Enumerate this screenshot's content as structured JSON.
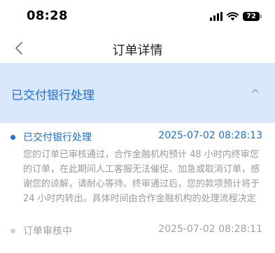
{
  "status_bar": {
    "time": "08:28",
    "battery": "72",
    "icons": [
      "signal-icon",
      "wifi-icon",
      "battery-icon"
    ]
  },
  "nav": {
    "back_glyph": "‹",
    "title": "订单详情"
  },
  "status_panel": {
    "title": "已交付银行处理",
    "toggle_icon": "chevron-up-icon"
  },
  "timeline": {
    "items": [
      {
        "title": "已交付银行处理",
        "time": "2025-07-02 08:28:13",
        "description": "您的订单已审核通过，合作金融机构预计 48 小时内终审您的订单，在此期间人工客服无法催促、加急或取消订单，感谢您的谅解，请耐心等待。终审通过后，您的款项预计将于 24 小时内转出。具体时间由合作金融机构的处理流程决定"
      },
      {
        "title": "订单审核中",
        "time": "2025-07-02 08:28:11"
      }
    ]
  },
  "colors": {
    "accent": "#1a6fe8",
    "panel_bg": "#d9e9fb",
    "muted_text": "#9a9a9a"
  }
}
